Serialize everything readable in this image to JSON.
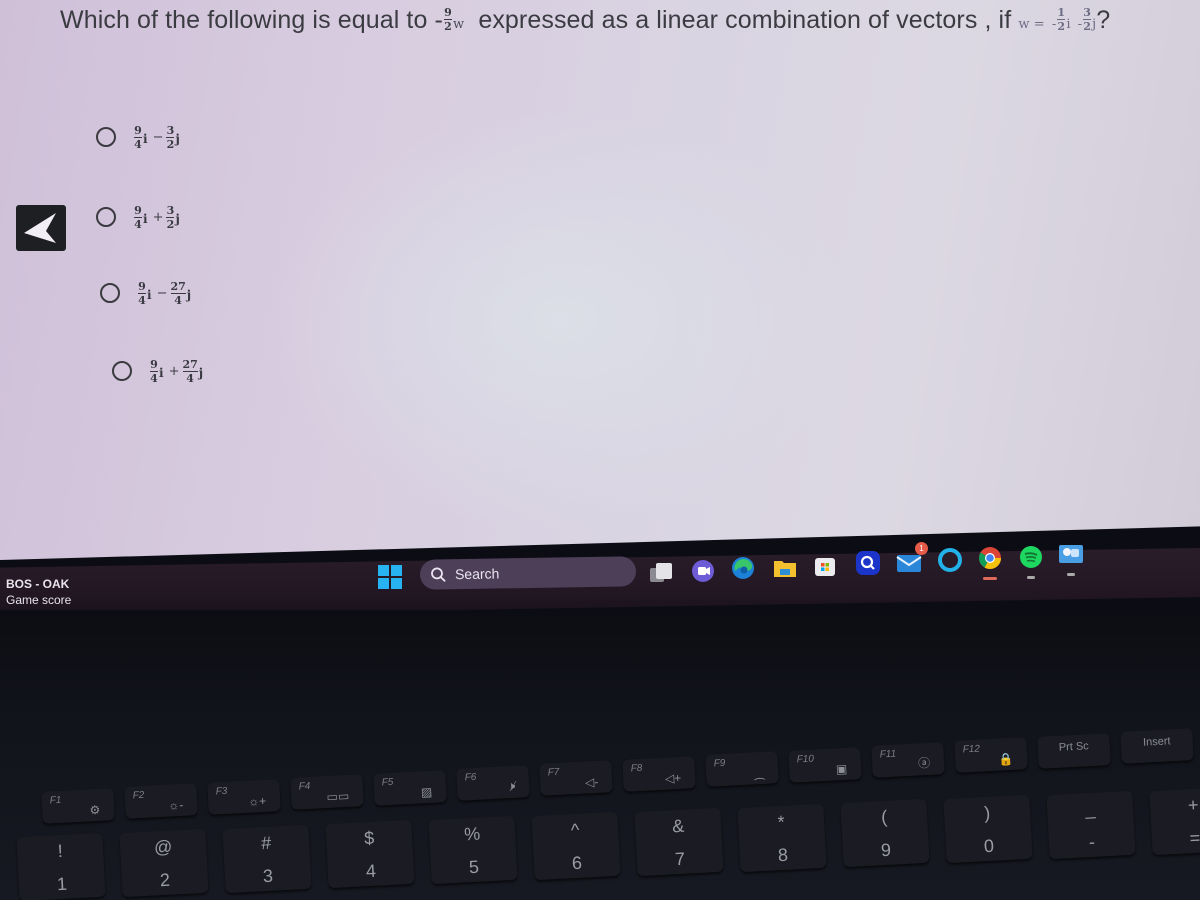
{
  "question": {
    "prefix": "Which of the following is equal to",
    "scalar": {
      "sign": "-",
      "numerator": "9",
      "denominator": "2"
    },
    "vector_name": "w",
    "middle": "expressed as a linear combination of vectors , if",
    "definition": {
      "lhs": "w =",
      "term1": {
        "sign": "-",
        "numerator": "1",
        "denominator": "2",
        "unit": "i"
      },
      "term2": {
        "sign": "-",
        "numerator": "3",
        "denominator": "2",
        "unit": "j"
      },
      "suffix": "?"
    }
  },
  "options": [
    {
      "a_num": "9",
      "a_den": "4",
      "a_unit": "i",
      "op": "−",
      "b_num": "3",
      "b_den": "2",
      "b_unit": "j",
      "selected": false
    },
    {
      "a_num": "9",
      "a_den": "4",
      "a_unit": "i",
      "op": "+",
      "b_num": "3",
      "b_den": "2",
      "b_unit": "j",
      "selected": false
    },
    {
      "a_num": "9",
      "a_den": "4",
      "a_unit": "i",
      "op": "−",
      "b_num": "27",
      "b_den": "4",
      "b_unit": "j",
      "selected": false
    },
    {
      "a_num": "9",
      "a_den": "4",
      "a_unit": "i",
      "op": "+",
      "b_num": "27",
      "b_den": "4",
      "b_unit": "j",
      "selected": false
    }
  ],
  "navigation": {
    "back_icon": "arrow-left-icon"
  },
  "taskbar": {
    "widget": {
      "title": "BOS - OAK",
      "subtitle": "Game score"
    },
    "search": {
      "label": "Search",
      "icon": "search-icon"
    },
    "apps": [
      {
        "name": "task-view",
        "icon": "task-view-icon",
        "active": false
      },
      {
        "name": "teams-meet",
        "icon": "video-chat-icon",
        "active": false
      },
      {
        "name": "edge",
        "icon": "edge-browser-icon",
        "active": false
      },
      {
        "name": "file-explorer",
        "icon": "folder-icon",
        "active": false
      },
      {
        "name": "microsoft-store",
        "icon": "store-icon",
        "active": false
      },
      {
        "name": "search-app",
        "icon": "search-app-icon",
        "active": false
      },
      {
        "name": "mail",
        "icon": "mail-icon",
        "active": false,
        "badge": "1"
      },
      {
        "name": "alexa",
        "icon": "alexa-icon",
        "active": false
      },
      {
        "name": "chrome",
        "icon": "chrome-icon",
        "active": true
      },
      {
        "name": "spotify",
        "icon": "spotify-icon",
        "active": false,
        "running": true
      },
      {
        "name": "weather-app",
        "icon": "weather-icon",
        "active": false,
        "running": true
      }
    ],
    "colors": {
      "start_blue": "#27b3f2",
      "badge_red": "#e55b47",
      "chrome_active": "#e06a5a"
    }
  },
  "keyboard": {
    "function_row": [
      {
        "label": "F1",
        "icon": "⚙"
      },
      {
        "label": "F2",
        "icon": "☼-"
      },
      {
        "label": "F3",
        "icon": "☼+"
      },
      {
        "label": "F4",
        "icon": "▭▭"
      },
      {
        "label": "F5",
        "icon": "▨"
      },
      {
        "label": "F6",
        "icon": "🕨̸"
      },
      {
        "label": "F7",
        "icon": "◁-"
      },
      {
        "label": "F8",
        "icon": "◁+"
      },
      {
        "label": "F9",
        "icon": "⁔"
      },
      {
        "label": "F10",
        "icon": "▣"
      },
      {
        "label": "F11",
        "icon": "ⓐ"
      },
      {
        "label": "F12",
        "icon": "🔒"
      },
      {
        "label": "Prt Sc",
        "icon": ""
      },
      {
        "label": "Insert",
        "icon": ""
      }
    ],
    "number_row": [
      {
        "shift": "!",
        "main": "1"
      },
      {
        "shift": "@",
        "main": "2"
      },
      {
        "shift": "#",
        "main": "3"
      },
      {
        "shift": "$",
        "main": "4"
      },
      {
        "shift": "%",
        "main": "5"
      },
      {
        "shift": "^",
        "main": "6"
      },
      {
        "shift": "&",
        "main": "7"
      },
      {
        "shift": "*",
        "main": "8"
      },
      {
        "shift": "(",
        "main": "9"
      },
      {
        "shift": ")",
        "main": "0"
      },
      {
        "shift": "_",
        "main": "-"
      },
      {
        "shift": "+",
        "main": "="
      }
    ]
  }
}
